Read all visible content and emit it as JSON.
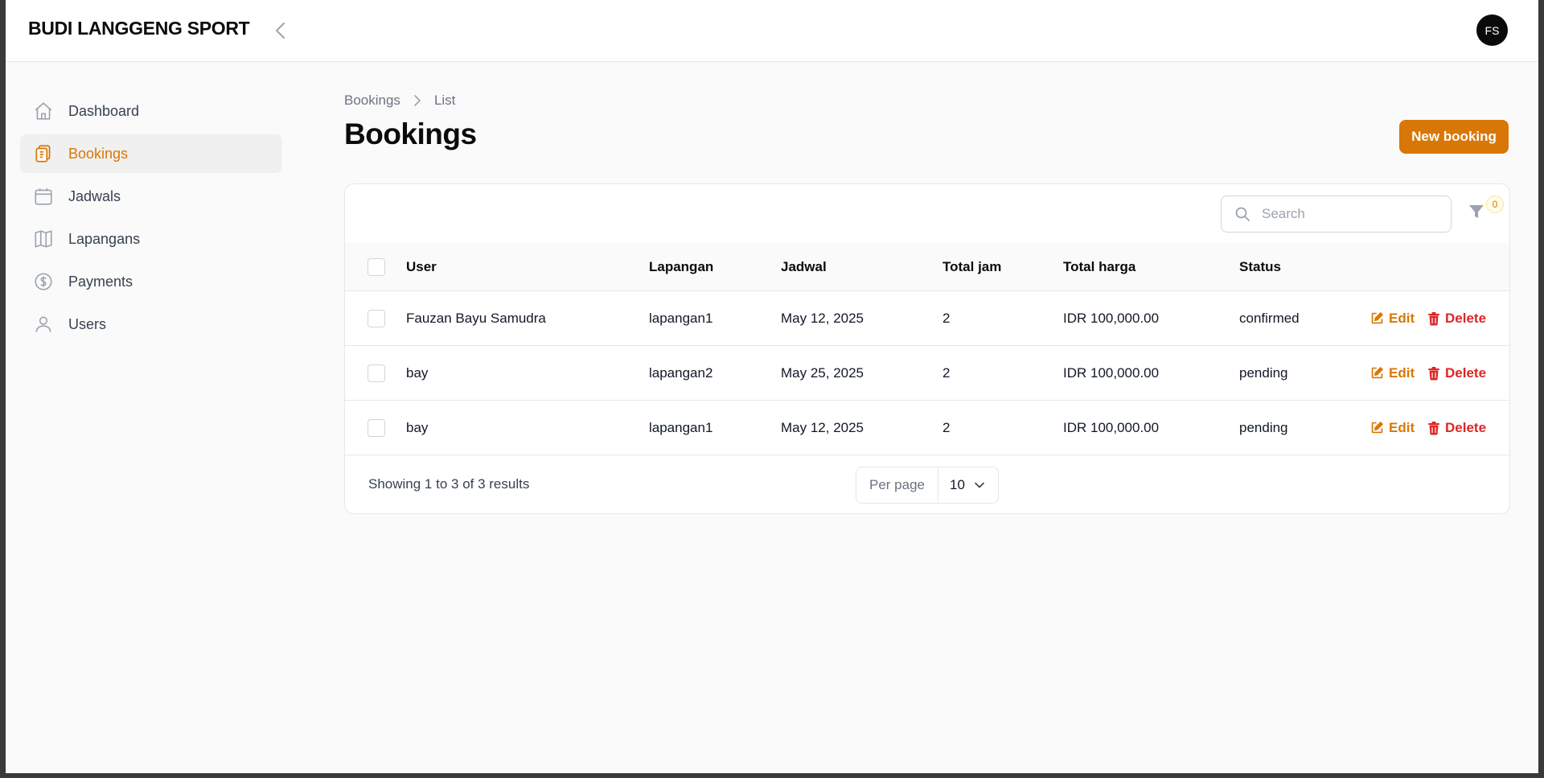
{
  "app": {
    "brand": "BUDI LANGGENG SPORT",
    "avatar_initials": "FS"
  },
  "sidebar": {
    "items": [
      {
        "label": "Dashboard",
        "icon": "home-icon"
      },
      {
        "label": "Bookings",
        "icon": "clipboard-icon",
        "active": true
      },
      {
        "label": "Jadwals",
        "icon": "calendar-icon"
      },
      {
        "label": "Lapangans",
        "icon": "map-icon"
      },
      {
        "label": "Payments",
        "icon": "dollar-circle-icon"
      },
      {
        "label": "Users",
        "icon": "user-icon"
      }
    ]
  },
  "breadcrumb": {
    "parent": "Bookings",
    "current": "List"
  },
  "page": {
    "title": "Bookings",
    "new_button": "New booking"
  },
  "table": {
    "search_placeholder": "Search",
    "filter_count": "0",
    "columns": [
      "User",
      "Lapangan",
      "Jadwal",
      "Total jam",
      "Total harga",
      "Status"
    ],
    "rows": [
      {
        "user": "Fauzan Bayu Samudra",
        "lapangan": "lapangan1",
        "jadwal": "May 12, 2025",
        "total_jam": "2",
        "total_harga": "IDR 100,000.00",
        "status": "confirmed"
      },
      {
        "user": "bay",
        "lapangan": "lapangan2",
        "jadwal": "May 25, 2025",
        "total_jam": "2",
        "total_harga": "IDR 100,000.00",
        "status": "pending"
      },
      {
        "user": "bay",
        "lapangan": "lapangan1",
        "jadwal": "May 12, 2025",
        "total_jam": "2",
        "total_harga": "IDR 100,000.00",
        "status": "pending"
      }
    ],
    "edit_label": "Edit",
    "delete_label": "Delete",
    "summary": "Showing 1 to 3 of 3 results",
    "per_page_label": "Per page",
    "per_page_value": "10"
  },
  "colors": {
    "accent": "#d97706",
    "danger": "#dc2626"
  }
}
